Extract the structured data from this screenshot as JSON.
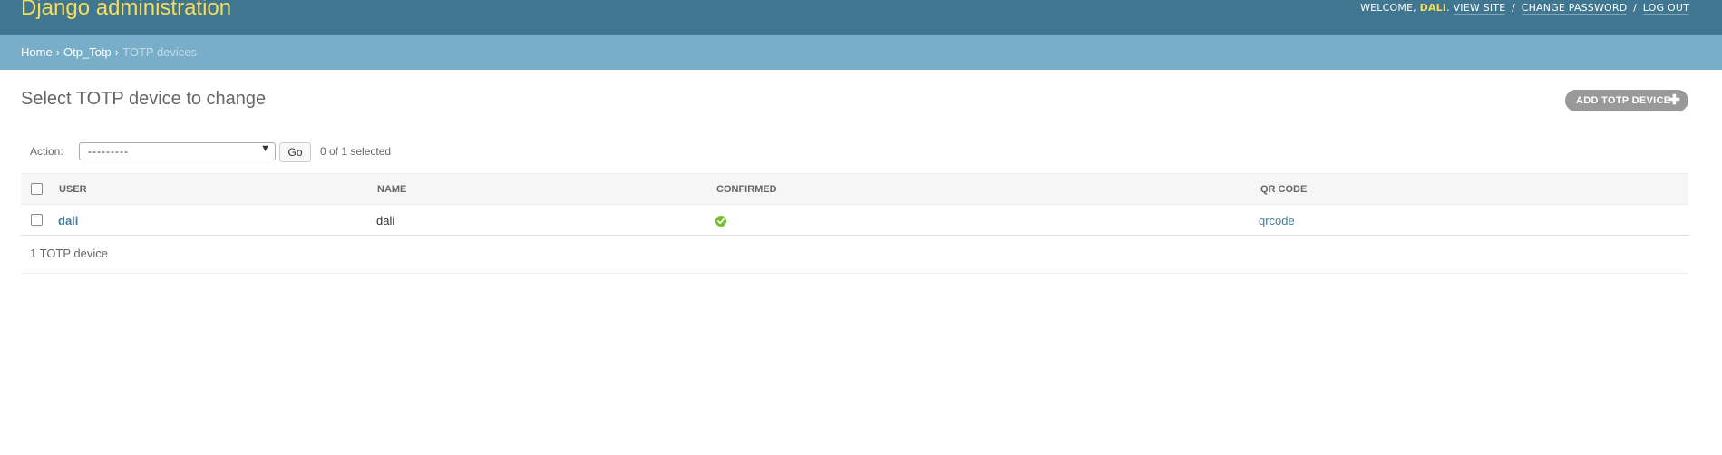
{
  "header": {
    "branding": "Django administration",
    "welcome": "WELCOME,",
    "username": "DALI",
    "view_site": "VIEW SITE",
    "change_password": "CHANGE PASSWORD",
    "log_out": "LOG OUT"
  },
  "breadcrumbs": {
    "home": "Home",
    "app": "Otp_Totp",
    "current": "TOTP devices"
  },
  "content": {
    "title": "Select TOTP device to change",
    "add_button": "ADD TOTP DEVICE"
  },
  "actions": {
    "label": "Action:",
    "selected_option": "---------",
    "go": "Go",
    "counter": "0 of 1 selected"
  },
  "table": {
    "headers": [
      "USER",
      "NAME",
      "CONFIRMED",
      "QR CODE"
    ],
    "rows": [
      {
        "user": "dali",
        "name": "dali",
        "confirmed": true,
        "qr_code": "qrcode"
      }
    ]
  },
  "paginator": "1 TOTP device",
  "colors": {
    "header_bg": "#417690",
    "branding": "#f5dd5d",
    "breadcrumb_bg": "#79aec8",
    "link": "#447e9b",
    "confirmed_icon": "#70bf2b"
  },
  "icons": {
    "add": "plus-icon",
    "confirmed": "check-circle-icon",
    "select_caret": "caret-down-icon"
  }
}
